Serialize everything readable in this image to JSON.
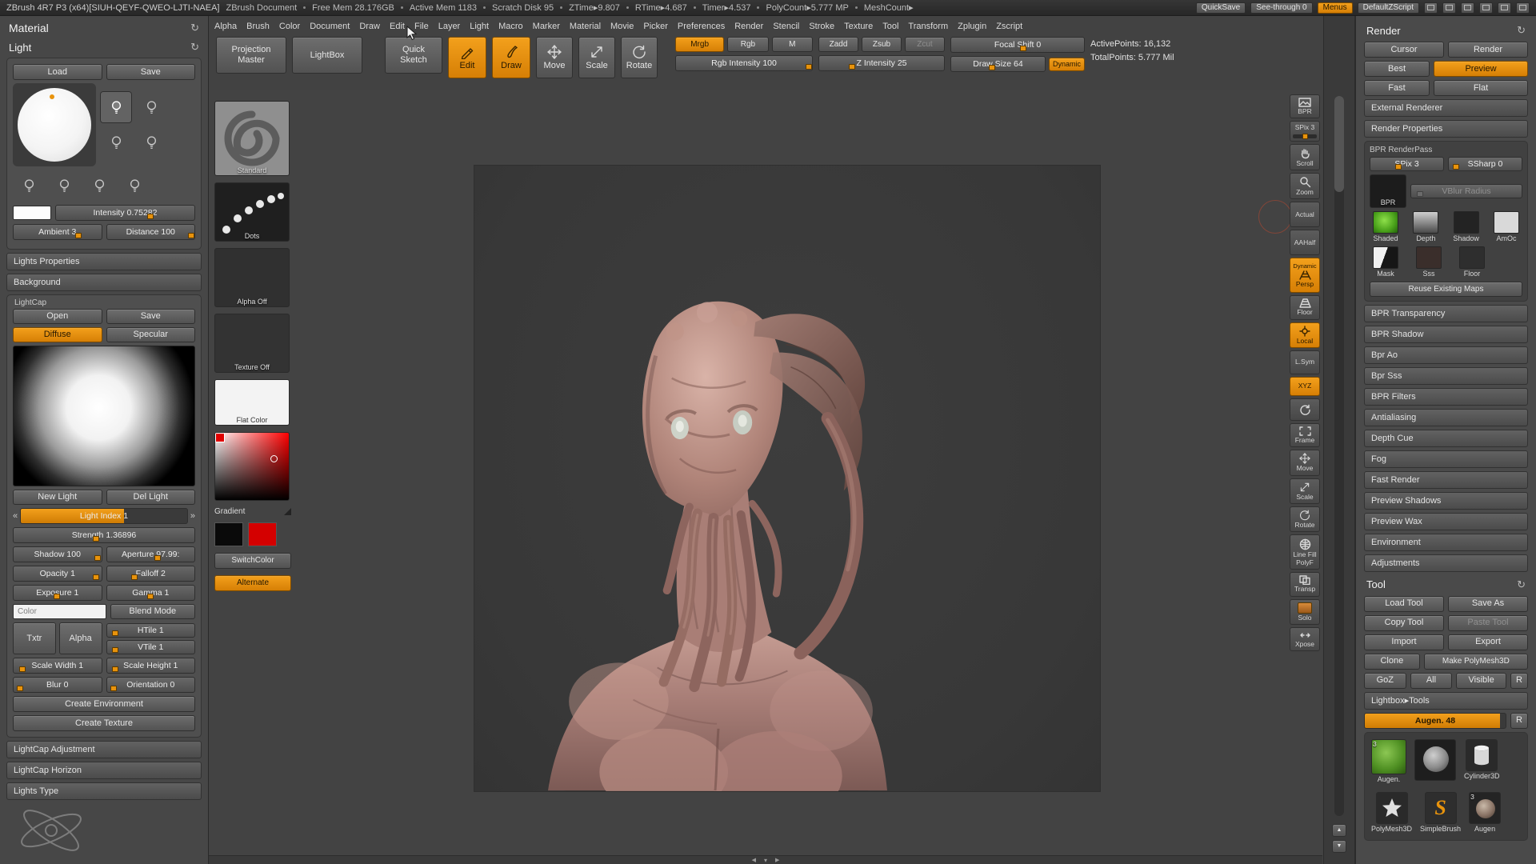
{
  "icons": {
    "refresh": "↻",
    "up": "▲",
    "down": "▼",
    "prev": "«",
    "next": "»",
    "marker": "▾",
    "left": "◀",
    "right": "▶"
  },
  "title_bar": {
    "app_title": "ZBrush 4R7 P3 (x64)[SIUH-QEYF-QWEO-LJTI-NAEA]",
    "doc_title": "ZBrush Document",
    "stats": [
      "Free Mem 28.176GB",
      "Active Mem 1183",
      "Scratch Disk 95",
      "ZTime▸9.807",
      "RTime▸4.687",
      "Timer▸4.537",
      "PolyCount▸5.777 MP",
      "MeshCount▸"
    ],
    "quicksave": "QuickSave",
    "see_through": "See-through 0",
    "menus_btn": "Menus",
    "default_zscript": "DefaultZScript"
  },
  "menu_bar": {
    "items": [
      "Alpha",
      "Brush",
      "Color",
      "Document",
      "Draw",
      "Edit",
      "File",
      "Layer",
      "Light",
      "Macro",
      "Marker",
      "Material",
      "Movie",
      "Picker",
      "Preferences",
      "Render",
      "Stencil",
      "Stroke",
      "Texture",
      "Tool",
      "Transform",
      "Zplugin",
      "Zscript"
    ]
  },
  "left_palette": {
    "material_title": "Material",
    "light_title": "Light",
    "load": "Load",
    "save": "Save",
    "intensity": "Intensity 0.75282",
    "ambient": "Ambient 3",
    "distance": "Distance 100",
    "lights_properties": "Lights Properties",
    "background": "Background",
    "lightcap_title": "LightCap",
    "open": "Open",
    "save2": "Save",
    "diffuse": "Diffuse",
    "specular": "Specular",
    "new_light": "New Light",
    "del_light": "Del Light",
    "light_index": "Light Index 1",
    "strength": "Strength 1.36896",
    "shadow": "Shadow 100",
    "aperture": "Aperture 97.99:",
    "opacity": "Opacity 1",
    "falloff": "Falloff 2",
    "exposure": "Exposure 1",
    "gamma": "Gamma 1",
    "color_label": "Color",
    "blend_mode": "Blend Mode",
    "txtr": "Txtr",
    "alpha": "Alpha",
    "htile": "HTile 1",
    "vtile": "VTile 1",
    "scale_width": "Scale Width 1",
    "scale_height": "Scale Height 1",
    "blur": "Blur 0",
    "orientation": "Orientation 0",
    "create_environment": "Create Environment",
    "create_texture": "Create Texture",
    "lightcap_adjustment": "LightCap Adjustment",
    "lightcap_horizon": "LightCap Horizon",
    "lights_type": "Lights Type"
  },
  "tray": {
    "projection_master": "Projection Master",
    "lightbox": "LightBox",
    "brush": "Standard",
    "stroke": "Dots",
    "alpha_off": "Alpha Off",
    "texture_off": "Texture Off",
    "flat_color": "Flat Color",
    "gradient": "Gradient",
    "switch_color": "SwitchColor",
    "alternate": "Alternate"
  },
  "shelf": {
    "quick_sketch": "Quick Sketch",
    "edit": "Edit",
    "draw": "Draw",
    "move": "Move",
    "scale": "Scale",
    "rotate": "Rotate",
    "mrgb": "Mrgb",
    "rgb": "Rgb",
    "m": "M",
    "rgb_intensity": "Rgb Intensity 100",
    "zadd": "Zadd",
    "zsub": "Zsub",
    "zcut": "Zcut",
    "z_intensity": "Z Intensity 25",
    "focal_shift": "Focal Shift 0",
    "draw_size": "Draw Size 64",
    "dynamic": "Dynamic",
    "active_points": "ActivePoints: 16,132",
    "total_points": "TotalPoints: 5.777 Mil"
  },
  "right_shelf": {
    "bpr": "BPR",
    "spix": "SPix 3",
    "scroll": "Scroll",
    "zoom": "Zoom",
    "actual": "Actual",
    "aahalf": "AAHalf",
    "dynamic": "Dynamic",
    "persp": "Persp",
    "floor": "Floor",
    "local": "Local",
    "lsym": "L.Sym",
    "xyz": "XYZ",
    "frame": "Frame",
    "move": "Move",
    "scale": "Scale",
    "rotate": "Rotate",
    "line_fill": "Line Fill",
    "polyf": "PolyF",
    "transp": "Transp",
    "solo": "Solo",
    "xpose": "Xpose"
  },
  "render_panel": {
    "title": "Render",
    "cursor": "Cursor",
    "render": "Render",
    "best": "Best",
    "preview": "Preview",
    "fast": "Fast",
    "flat": "Flat",
    "external_renderer": "External Renderer",
    "render_properties": "Render Properties",
    "bpr_title": "BPR RenderPass",
    "spix": "SPix 3",
    "ssharp": "SSharp 0",
    "vblur": "VBlur Radius",
    "bpr": "BPR",
    "pass_shaded": "Shaded",
    "pass_depth": "Depth",
    "pass_shadow": "Shadow",
    "pass_amoc": "AmOc",
    "pass_mask": "Mask",
    "pass_sss": "Sss",
    "pass_floor": "Floor",
    "reuse": "Reuse Existing Maps",
    "sections": [
      "BPR Transparency",
      "BPR Shadow",
      "Bpr Ao",
      "Bpr Sss",
      "BPR Filters",
      "Antialiasing",
      "Depth Cue",
      "Fog",
      "Fast Render",
      "Preview Shadows",
      "Preview Wax",
      "Environment",
      "Adjustments"
    ]
  },
  "tool_panel": {
    "title": "Tool",
    "load_tool": "Load Tool",
    "save_as": "Save As",
    "copy_tool": "Copy Tool",
    "paste_tool": "Paste Tool",
    "import": "Import",
    "export": "Export",
    "clone": "Clone",
    "make_polymesh": "Make PolyMesh3D",
    "goz": "GoZ",
    "all": "All",
    "visible": "Visible",
    "r": "R",
    "lightbox_tools": "Lightbox▸Tools",
    "item_slider": "Augen. 48",
    "r2": "R",
    "badge": "3",
    "tool1": "Augen.",
    "tool2": "Cylinder3D",
    "tool3": "PolyMesh3D",
    "tool4": "SimpleBrush",
    "tool5": "Augen"
  }
}
